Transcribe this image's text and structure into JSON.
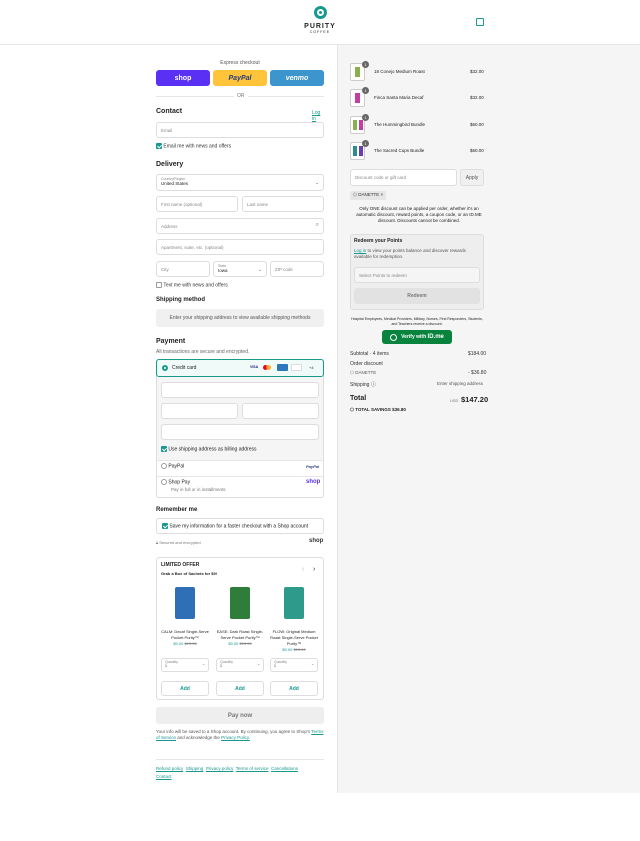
{
  "header": {
    "brand": "PURITY",
    "brand_sub": "COFFEE",
    "accent": "#17998f"
  },
  "express": {
    "label": "Express checkout",
    "shop": "shop",
    "paypal": "PayPal",
    "venmo": "venmo",
    "or": "OR"
  },
  "contact": {
    "title": "Contact",
    "login": "Log in",
    "email_placeholder": "Email",
    "news": "Email me with news and offers"
  },
  "delivery": {
    "title": "Delivery",
    "country_label": "Country/Region",
    "country": "United States",
    "first": "First name (optional)",
    "last": "Last name",
    "address": "Address",
    "apt": "Apartment, suite, etc. (optional)",
    "city": "City",
    "state_label": "State",
    "state": "Iowa",
    "zip": "ZIP code",
    "text_me": "Text me with news and offers"
  },
  "shipping": {
    "title": "Shipping method",
    "msg": "Enter your shipping address to view available shipping methods"
  },
  "payment": {
    "title": "Payment",
    "sub": "All transactions are secure and encrypted.",
    "credit": "Credit card",
    "visa": "VISA",
    "more": "+4",
    "billing": "Use shipping address as billing address",
    "paypal": "PayPal",
    "paypal_logo": "PayPal",
    "shoppay": "Shop Pay",
    "shoppay_sub": "Pay in full or in installments",
    "shop_logo": "shop"
  },
  "remember": {
    "title": "Remember me",
    "save": "Save my information for a faster checkout with a Shop account",
    "secure": "Secured and encrypted",
    "shop": "shop"
  },
  "offer": {
    "title": "LIMITED OFFER",
    "sub": "Grab a Box of Sachets for $9!",
    "items": [
      {
        "name": "CALM: Decaf Single-Serve Pocket Purity™",
        "price": "$9.00",
        "old": "$13.00",
        "qty_label": "Quantity",
        "qty": "1",
        "add": "Add",
        "color": "#2f6fb5"
      },
      {
        "name": "EASE: Dark Roast Single-Serve Pocket Purity™",
        "price": "$9.00",
        "old": "$13.00",
        "qty_label": "Quantity",
        "qty": "1",
        "add": "Add",
        "color": "#2e7d3a"
      },
      {
        "name": "FLOW: Original Medium Roast Single-Serve Pocket Purity™",
        "price": "$9.00",
        "old": "$13.00",
        "qty_label": "Quantity",
        "qty": "1",
        "add": "Add",
        "color": "#2e9a8c"
      }
    ]
  },
  "paynow": "Pay now",
  "legal": {
    "t1": "Your info will be saved to a Shop account. By continuing, you agree to Shop's",
    "tos": "Terms of Service",
    "t2": "and acknowledge the",
    "pp": "Privacy Policy."
  },
  "footer": [
    "Refund policy",
    "Shipping",
    "Privacy policy",
    "Terms of service",
    "Cancellations",
    "Contact"
  ],
  "cart": {
    "items": [
      {
        "name": "18 Conejo Medium Roast",
        "price": "$32.00",
        "qty": "1"
      },
      {
        "name": "Finca Santa Maria Decaf",
        "price": "$32.00",
        "qty": "1"
      },
      {
        "name": "The Hummingbird Bundle",
        "price": "$60.00",
        "qty": "1"
      },
      {
        "name": "The Sacred Cups Bundle",
        "price": "$60.00",
        "qty": "1"
      }
    ],
    "discount_placeholder": "Discount code or gift card",
    "apply": "Apply",
    "tag": "DANETTE",
    "note": "Only ONE discount can be applied per order, whether it's an automatic discount, reward points, a coupon code, or an ID.ME discount. Discounts cannot be combined.",
    "redeem": {
      "title": "Redeem your Points",
      "login": "Log in",
      "text": "to view your points balance and discover rewards available for redemption.",
      "select": "Select Points to redeem",
      "btn": "Redeem"
    },
    "idme_note": "Hospital Employees, Medical Providers, Military, Nurses, First Responders, Students, and Teachers receive a discount.",
    "idme_btn": "Verify with",
    "idme_logo": "ID.me",
    "subtotal_label": "Subtotal · 4 items",
    "subtotal": "$184.00",
    "order_discount": "Order discount",
    "disc_code": "DANETTE",
    "disc_amt": "- $36.80",
    "shipping_label": "Shipping",
    "shipping_val": "Enter shipping address",
    "total_label": "Total",
    "currency": "USD",
    "total": "$147.20",
    "savings_label": "TOTAL SAVINGS",
    "savings": "$36.80"
  }
}
